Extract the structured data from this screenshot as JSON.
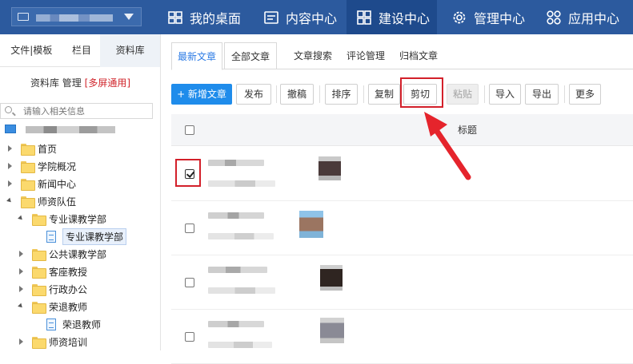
{
  "nav": {
    "site_selector": {
      "value_hidden": true
    },
    "items": [
      {
        "label": "我的桌面",
        "icon": "desktop-icon",
        "active": false
      },
      {
        "label": "内容中心",
        "icon": "content-icon",
        "active": false
      },
      {
        "label": "建设中心",
        "icon": "grid-icon",
        "active": true
      },
      {
        "label": "管理中心",
        "icon": "gear-icon",
        "active": false
      },
      {
        "label": "应用中心",
        "icon": "apps-icon",
        "active": false
      }
    ]
  },
  "sidebar": {
    "tabs": [
      "文件|模板",
      "栏目",
      "资料库"
    ],
    "active_tab": "资料库",
    "title_prefix": "资料库 管理",
    "title_badge": "[多屏通用]",
    "search_placeholder": "请输入相关信息",
    "tree": [
      {
        "label": "首页",
        "level": 0,
        "expanded": false,
        "type": "folder"
      },
      {
        "label": "学院概况",
        "level": 0,
        "expanded": false,
        "type": "folder"
      },
      {
        "label": "新闻中心",
        "level": 0,
        "expanded": false,
        "type": "folder"
      },
      {
        "label": "师资队伍",
        "level": 0,
        "expanded": true,
        "type": "folder"
      },
      {
        "label": "专业课教学部",
        "level": 1,
        "expanded": true,
        "type": "folder"
      },
      {
        "label": "专业课教学部",
        "level": 2,
        "type": "doc",
        "selected": true
      },
      {
        "label": "公共课教学部",
        "level": 1,
        "expanded": false,
        "type": "folder"
      },
      {
        "label": "客座教授",
        "level": 1,
        "expanded": false,
        "type": "folder"
      },
      {
        "label": "行政办公",
        "level": 1,
        "expanded": false,
        "type": "folder"
      },
      {
        "label": "荣退教师",
        "level": 1,
        "expanded": true,
        "type": "folder"
      },
      {
        "label": "荣退教师",
        "level": 2,
        "type": "doc"
      },
      {
        "label": "师资培训",
        "level": 1,
        "expanded": false,
        "type": "folder"
      }
    ]
  },
  "main": {
    "tabs": [
      "最新文章",
      "全部文章",
      "文章搜索",
      "评论管理",
      "归档文章"
    ],
    "active_tab": "最新文章",
    "toolbar": {
      "add": "+ 新增文章",
      "publish": "发布",
      "withdraw": "撤稿",
      "sort": "排序",
      "copy": "复制",
      "cut": "剪切",
      "paste": "粘贴",
      "import": "导入",
      "export": "导出",
      "more": "更多"
    },
    "table": {
      "header_title": "标题",
      "rows": [
        {
          "checked": true
        },
        {
          "checked": false
        },
        {
          "checked": false
        },
        {
          "checked": false
        }
      ]
    }
  },
  "colors": {
    "nav_bg": "#2c5a9e",
    "nav_active": "#1e4a8c",
    "primary": "#1f8ceb",
    "highlight_red": "#d3202a"
  }
}
